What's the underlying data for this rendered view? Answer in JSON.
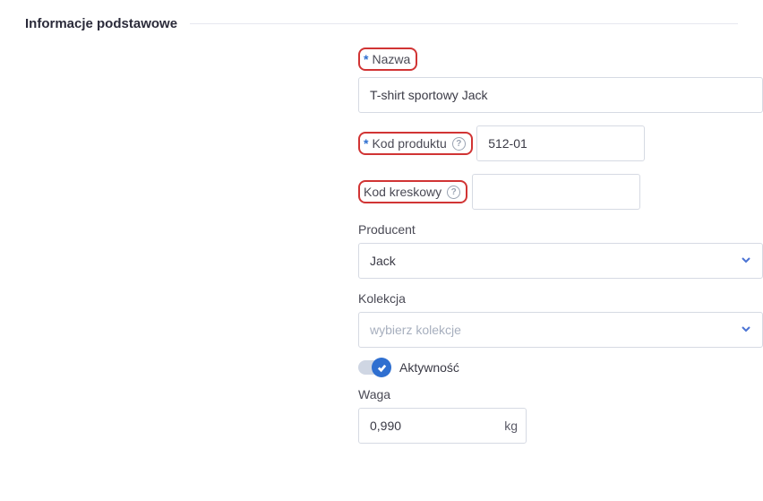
{
  "section": {
    "title": "Informacje podstawowe"
  },
  "fields": {
    "name": {
      "label": "Nazwa",
      "value": "T-shirt sportowy Jack"
    },
    "product_code": {
      "label": "Kod produktu",
      "value": "512-01"
    },
    "barcode": {
      "label": "Kod kreskowy",
      "value": ""
    },
    "producer": {
      "label": "Producent",
      "value": "Jack"
    },
    "collection": {
      "label": "Kolekcja",
      "placeholder": "wybierz kolekcje"
    },
    "activity": {
      "label": "Aktywność"
    },
    "weight": {
      "label": "Waga",
      "value": "0,990",
      "unit": "kg"
    }
  }
}
